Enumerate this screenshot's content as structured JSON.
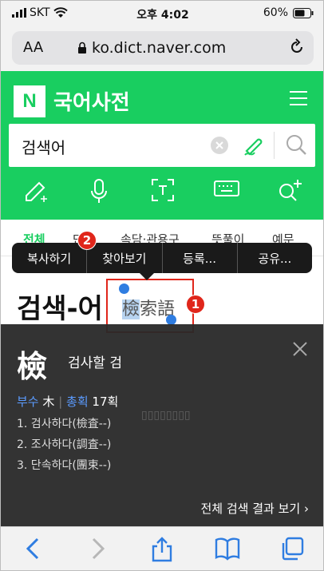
{
  "status_bar": {
    "carrier": "SKT",
    "time": "오후 4:02",
    "battery": "60%"
  },
  "browser": {
    "text_size_button": "AA",
    "url": "ko.dict.naver.com"
  },
  "header": {
    "logo_letter": "N",
    "title": "국어사전",
    "search_value": "검색어"
  },
  "tabs": [
    "전체",
    "단어",
    "속담·관용구",
    "뜻풀이",
    "예문"
  ],
  "context_menu": [
    "복사하기",
    "찾아보기",
    "등록...",
    "공유..."
  ],
  "entry": {
    "headword": "검색-어",
    "hanja_selected": "檢",
    "hanja_rest": "索語"
  },
  "annotations": {
    "badge_1": "1",
    "badge_2": "2"
  },
  "lookup_panel": {
    "character": "檢",
    "meaning": "검사할 검",
    "radical_label": "부수",
    "radical": "木",
    "strokes_label": "총획",
    "strokes": "17획",
    "definitions": [
      "1. 검사하다(檢査--)",
      "2. 조사하다(調査--)",
      "3. 단속하다(團束--)"
    ],
    "more_link": "전체 검색 결과 보기"
  },
  "colors": {
    "brand_green": "#19ce60",
    "highlight": "#b7d3f0",
    "annotation_red": "#e0261b",
    "link_blue": "#2f7de1"
  }
}
